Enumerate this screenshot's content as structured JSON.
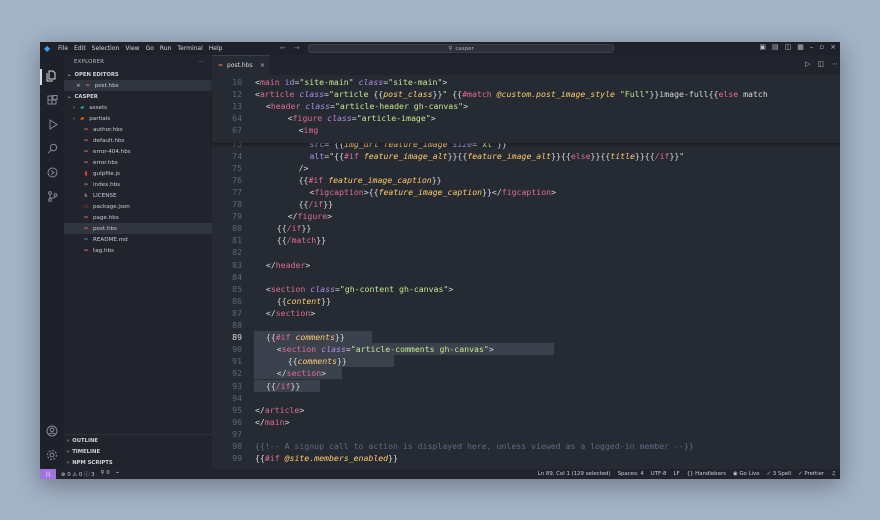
{
  "titlebar": {
    "menu": [
      "File",
      "Edit",
      "Selection",
      "View",
      "Go",
      "Run",
      "Terminal",
      "Help"
    ],
    "search": "casper"
  },
  "sidebar": {
    "title": "EXPLORER",
    "more": "···",
    "open_editors_label": "OPEN EDITORS",
    "open_editor_file": "post.hbs",
    "project_label": "CASPER",
    "folders": [
      "assets",
      "partials"
    ],
    "files": [
      {
        "name": "author.hbs",
        "icon": "hbs"
      },
      {
        "name": "default.hbs",
        "icon": "hbs"
      },
      {
        "name": "error-404.hbs",
        "icon": "hbs"
      },
      {
        "name": "error.hbs",
        "icon": "hbs"
      },
      {
        "name": "gulpfile.js",
        "icon": "gulp"
      },
      {
        "name": "index.hbs",
        "icon": "hbs"
      },
      {
        "name": "LICENSE",
        "icon": "license"
      },
      {
        "name": "package.json",
        "icon": "npm"
      },
      {
        "name": "page.hbs",
        "icon": "hbs"
      },
      {
        "name": "post.hbs",
        "icon": "hbs",
        "selected": true
      },
      {
        "name": "README.md",
        "icon": "md"
      },
      {
        "name": "tag.hbs",
        "icon": "hbs"
      }
    ],
    "bottom_sections": [
      "OUTLINE",
      "TIMELINE",
      "NPM SCRIPTS"
    ]
  },
  "tab": {
    "label": "post.hbs",
    "close": "×"
  },
  "colors": {
    "accent": "#a173e0",
    "tag": "#e06c96",
    "attr": "#ad8ee6",
    "string": "#c4e88d",
    "var": "#ffcb6b",
    "comment": "#5f6b84"
  },
  "editor": {
    "current_line": "89",
    "sticky": [
      {
        "n": "10",
        "indent": 0,
        "tokens": [
          [
            "p",
            "<"
          ],
          [
            "t",
            "main"
          ],
          [
            "p",
            " "
          ],
          [
            "a",
            "id"
          ],
          [
            "p",
            "="
          ],
          [
            "s",
            "\"site-main\""
          ],
          [
            "p",
            " "
          ],
          [
            "ai",
            "class"
          ],
          [
            "p",
            "="
          ],
          [
            "s",
            "\"site-main\""
          ],
          [
            "p",
            ">"
          ]
        ]
      },
      {
        "n": "12",
        "indent": 0,
        "tokens": [
          [
            "p",
            "<"
          ],
          [
            "t",
            "article"
          ],
          [
            "p",
            " "
          ],
          [
            "ai",
            "class"
          ],
          [
            "p",
            "="
          ],
          [
            "s",
            "\"article "
          ],
          [
            "p",
            "{{"
          ],
          [
            "v",
            "post_class"
          ],
          [
            "p",
            "}}"
          ],
          [
            "s",
            "\""
          ],
          [
            "p",
            " {{"
          ],
          [
            "k",
            "#match"
          ],
          [
            "p",
            " "
          ],
          [
            "v",
            "@custom.post_image_style"
          ],
          [
            "p",
            " "
          ],
          [
            "s",
            "\"Full\""
          ],
          [
            "p",
            "}}image-full{{"
          ],
          [
            "k",
            "else"
          ],
          [
            "p",
            " match"
          ]
        ]
      },
      {
        "n": "13",
        "indent": 2,
        "tokens": [
          [
            "p",
            "<"
          ],
          [
            "t",
            "header"
          ],
          [
            "p",
            " "
          ],
          [
            "ai",
            "class"
          ],
          [
            "p",
            "="
          ],
          [
            "s",
            "\"article-header gh-canvas\""
          ],
          [
            "p",
            ">"
          ]
        ]
      },
      {
        "n": "64",
        "indent": 6,
        "tokens": [
          [
            "p",
            "<"
          ],
          [
            "t",
            "figure"
          ],
          [
            "p",
            " "
          ],
          [
            "ai",
            "class"
          ],
          [
            "p",
            "="
          ],
          [
            "s",
            "\"article-image\""
          ],
          [
            "p",
            ">"
          ]
        ]
      },
      {
        "n": "67",
        "indent": 8,
        "tokens": [
          [
            "p",
            "<"
          ],
          [
            "t",
            "img"
          ]
        ]
      }
    ],
    "lines": [
      {
        "n": "73",
        "indent": 10,
        "tokens": [
          [
            "a",
            "src"
          ],
          [
            "p",
            "="
          ],
          [
            "s",
            "\""
          ],
          [
            "p",
            "{{"
          ],
          [
            "v",
            "img_url"
          ],
          [
            "p",
            " "
          ],
          [
            "v",
            "feature_image"
          ],
          [
            "p",
            " "
          ],
          [
            "ai",
            "size"
          ],
          [
            "p",
            "="
          ],
          [
            "s",
            "\"xl\""
          ],
          [
            "p",
            "}}"
          ],
          [
            "s",
            "\""
          ]
        ]
      },
      {
        "n": "74",
        "indent": 10,
        "tokens": [
          [
            "a",
            "alt"
          ],
          [
            "p",
            "="
          ],
          [
            "s",
            "\""
          ],
          [
            "p",
            "{{"
          ],
          [
            "k",
            "#if"
          ],
          [
            "p",
            " "
          ],
          [
            "v",
            "feature_image_alt"
          ],
          [
            "p",
            "}}{{"
          ],
          [
            "v",
            "feature_image_alt"
          ],
          [
            "p",
            "}}{{"
          ],
          [
            "k",
            "else"
          ],
          [
            "p",
            "}}{{"
          ],
          [
            "v",
            "title"
          ],
          [
            "p",
            "}}{{"
          ],
          [
            "k",
            "/if"
          ],
          [
            "p",
            "}}"
          ],
          [
            "s",
            "\""
          ]
        ]
      },
      {
        "n": "75",
        "indent": 8,
        "tokens": [
          [
            "p",
            "/>"
          ]
        ]
      },
      {
        "n": "76",
        "indent": 8,
        "tokens": [
          [
            "p",
            "{{"
          ],
          [
            "k",
            "#if"
          ],
          [
            "p",
            " "
          ],
          [
            "v",
            "feature_image_caption"
          ],
          [
            "p",
            "}}"
          ]
        ]
      },
      {
        "n": "77",
        "indent": 10,
        "tokens": [
          [
            "p",
            "<"
          ],
          [
            "t",
            "figcaption"
          ],
          [
            "p",
            ">{{"
          ],
          [
            "v",
            "feature_image_caption"
          ],
          [
            "p",
            "}}</"
          ],
          [
            "t",
            "figcaption"
          ],
          [
            "p",
            ">"
          ]
        ]
      },
      {
        "n": "78",
        "indent": 8,
        "tokens": [
          [
            "p",
            "{{"
          ],
          [
            "k",
            "/if"
          ],
          [
            "p",
            "}}"
          ]
        ]
      },
      {
        "n": "79",
        "indent": 6,
        "tokens": [
          [
            "p",
            "</"
          ],
          [
            "t",
            "figure"
          ],
          [
            "p",
            ">"
          ]
        ]
      },
      {
        "n": "80",
        "indent": 4,
        "tokens": [
          [
            "p",
            "{{"
          ],
          [
            "k",
            "/if"
          ],
          [
            "p",
            "}}"
          ]
        ]
      },
      {
        "n": "81",
        "indent": 4,
        "tokens": [
          [
            "p",
            "{{"
          ],
          [
            "k",
            "/match"
          ],
          [
            "p",
            "}}"
          ]
        ]
      },
      {
        "n": "82",
        "indent": 0,
        "tokens": []
      },
      {
        "n": "83",
        "indent": 2,
        "tokens": [
          [
            "p",
            "</"
          ],
          [
            "t",
            "header"
          ],
          [
            "p",
            ">"
          ]
        ]
      },
      {
        "n": "84",
        "indent": 0,
        "tokens": []
      },
      {
        "n": "85",
        "indent": 2,
        "tokens": [
          [
            "p",
            "<"
          ],
          [
            "t",
            "section"
          ],
          [
            "p",
            " "
          ],
          [
            "ai",
            "class"
          ],
          [
            "p",
            "="
          ],
          [
            "s",
            "\"gh-content gh-canvas\""
          ],
          [
            "p",
            ">"
          ]
        ]
      },
      {
        "n": "86",
        "indent": 4,
        "tokens": [
          [
            "p",
            "{{"
          ],
          [
            "v",
            "content"
          ],
          [
            "p",
            "}}"
          ]
        ]
      },
      {
        "n": "87",
        "indent": 2,
        "tokens": [
          [
            "p",
            "</"
          ],
          [
            "t",
            "section"
          ],
          [
            "p",
            ">"
          ]
        ]
      },
      {
        "n": "88",
        "indent": 0,
        "tokens": []
      },
      {
        "n": "89",
        "indent": 2,
        "sel": true,
        "tokens": [
          [
            "p",
            "{{"
          ],
          [
            "k",
            "#if"
          ],
          [
            "p",
            " "
          ],
          [
            "v",
            "comments"
          ],
          [
            "p",
            "}}"
          ]
        ]
      },
      {
        "n": "90",
        "indent": 4,
        "sel": true,
        "tokens": [
          [
            "p",
            "<"
          ],
          [
            "t",
            "section"
          ],
          [
            "p",
            " "
          ],
          [
            "ai",
            "class"
          ],
          [
            "p",
            "="
          ],
          [
            "s",
            "\"article-comments gh-canvas\""
          ],
          [
            "p",
            ">"
          ]
        ]
      },
      {
        "n": "91",
        "indent": 6,
        "sel": true,
        "tokens": [
          [
            "p",
            "{{"
          ],
          [
            "v",
            "comments"
          ],
          [
            "p",
            "}}"
          ]
        ]
      },
      {
        "n": "92",
        "indent": 4,
        "sel": true,
        "tokens": [
          [
            "p",
            "</"
          ],
          [
            "t",
            "section"
          ],
          [
            "p",
            ">"
          ]
        ]
      },
      {
        "n": "93",
        "indent": 2,
        "sel": true,
        "tokens": [
          [
            "p",
            "{{"
          ],
          [
            "k",
            "/if"
          ],
          [
            "p",
            "}}"
          ]
        ]
      },
      {
        "n": "94",
        "indent": 0,
        "tokens": []
      },
      {
        "n": "95",
        "indent": 0,
        "tokens": [
          [
            "p",
            "</"
          ],
          [
            "t",
            "article"
          ],
          [
            "p",
            ">"
          ]
        ]
      },
      {
        "n": "96",
        "indent": 0,
        "tokens": [
          [
            "p",
            "</"
          ],
          [
            "t",
            "main"
          ],
          [
            "p",
            ">"
          ]
        ]
      },
      {
        "n": "97",
        "indent": 0,
        "tokens": []
      },
      {
        "n": "98",
        "indent": 0,
        "tokens": [
          [
            "c",
            "{{!-- A signup call to action is displayed here, unless viewed as a logged-in member --}}"
          ]
        ]
      },
      {
        "n": "99",
        "indent": 0,
        "tokens": [
          [
            "p",
            "{{"
          ],
          [
            "k",
            "#if"
          ],
          [
            "p",
            " "
          ],
          [
            "v",
            "@site.members_enabled"
          ],
          [
            "p",
            "}}"
          ]
        ]
      }
    ]
  },
  "status": {
    "remote": "⟩⟨",
    "problems": "⊗ 0 ⚠ 0 ⓘ 3",
    "ports": "⚲ 0",
    "items": [
      "Ln 89, Col 1 (129 selected)",
      "Spaces: 4",
      "UTF-8",
      "LF",
      "{} Handlebars",
      "◉ Go Live",
      "✓ 3 Spell",
      "✓ Prettier"
    ]
  }
}
